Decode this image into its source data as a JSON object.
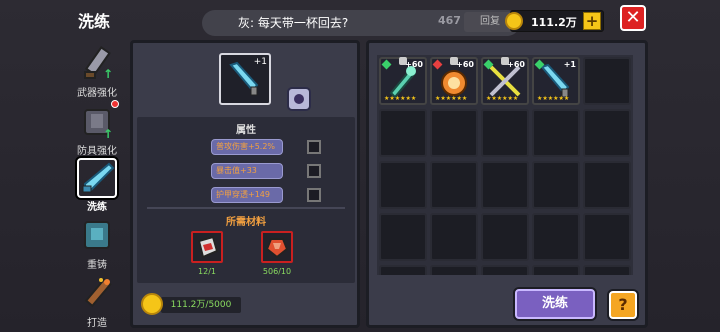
{
  "header": {
    "title": "洗练",
    "toast_text": "灰: 每天带一杯回去?",
    "hidden_count": "467",
    "hidden_button": "回复",
    "gold": "111.2万"
  },
  "sidebar": {
    "items": [
      {
        "label": "武器强化",
        "icon": "sword-icon"
      },
      {
        "label": "防具强化",
        "icon": "armor-icon"
      },
      {
        "label": "洗练",
        "icon": "crystal-sword-icon"
      },
      {
        "label": "重铸",
        "icon": "reforge-armor-icon"
      },
      {
        "label": "打造",
        "icon": "forge-hammer-icon"
      }
    ]
  },
  "left_panel": {
    "main_item_level": "+1",
    "attributes_title": "属性",
    "attributes": [
      {
        "text": "普攻伤害+5.2%"
      },
      {
        "text": "暴击值+33"
      },
      {
        "text": "护甲穿透+149"
      }
    ],
    "materials_title": "所需材料",
    "materials": [
      {
        "icon": "red-stone-icon",
        "count": "12/1"
      },
      {
        "icon": "purple-stone-icon",
        "count": "506/10"
      }
    ],
    "cost": "111.2万/5000"
  },
  "inventory": {
    "items": [
      {
        "level": "+60",
        "stars": "★★★★★★",
        "icon": "crystal-staff-icon",
        "marker": "#3ad06a"
      },
      {
        "level": "+60",
        "stars": "★★★★★★",
        "icon": "flame-orb-icon",
        "marker": "#e84040"
      },
      {
        "level": "+60",
        "stars": "★★★★★★",
        "icon": "crossed-swords-icon",
        "marker": "#3ad06a"
      },
      {
        "level": "+1",
        "stars": "★★★★★★",
        "icon": "crystal-dagger-icon",
        "marker": "#3ad06a"
      }
    ]
  },
  "actions": {
    "wash_label": "洗练",
    "help_label": "?"
  },
  "colors": {
    "accent": "#7a60c0",
    "close": "#dd2222",
    "gold": "#f5c518"
  }
}
